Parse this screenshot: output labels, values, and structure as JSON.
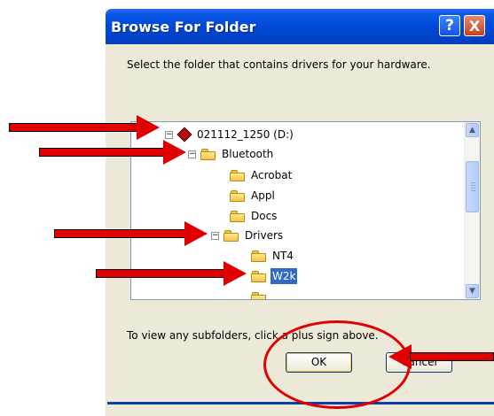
{
  "dialog": {
    "title": "Browse For Folder",
    "help_label": "?",
    "close_label": "X",
    "instruction": "Select the folder that contains drivers for your hardware.",
    "hint": "To view any subfolders, click a plus sign above.",
    "ok_label": "OK",
    "cancel_label": "Cancel"
  },
  "tree": {
    "drive": "021112_1250 (D:)",
    "items": [
      {
        "label": "Bluetooth",
        "expander": "−"
      },
      {
        "label": "Acrobat"
      },
      {
        "label": "Appl"
      },
      {
        "label": "Docs"
      },
      {
        "label": "Drivers",
        "expander": "−"
      },
      {
        "label": "NT4"
      },
      {
        "label": "W2k",
        "selected": true
      }
    ],
    "drive_expander": "−",
    "scroll_up": "▲",
    "scroll_down": "▼"
  },
  "colors": {
    "annotation": "#e00000",
    "selection": "#316ac5",
    "titlebar": "#0048d8"
  }
}
